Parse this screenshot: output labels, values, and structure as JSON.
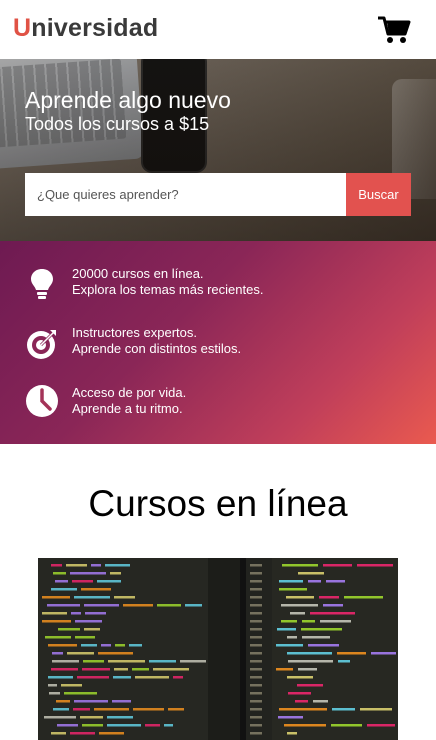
{
  "header": {
    "logo_first": "U",
    "logo_rest": "niversidad",
    "cart_icon": "shopping-cart-icon"
  },
  "hero": {
    "title": "Aprende algo nuevo",
    "subtitle": "Todos los cursos a $15",
    "search_placeholder": "¿Que quieres aprender?",
    "search_button": "Buscar"
  },
  "features": [
    {
      "icon": "lightbulb-icon",
      "line1": "20000 cursos en línea.",
      "line2": "Explora los temas más recientes."
    },
    {
      "icon": "target-icon",
      "line1": "Instructores expertos.",
      "line2": "Aprende con distintos estilos."
    },
    {
      "icon": "clock-icon",
      "line1": "Acceso de por vida.",
      "line2": "Aprende a tu ritmo."
    }
  ],
  "courses": {
    "title": "Cursos en línea"
  },
  "colors": {
    "accent": "#e2524f",
    "gradient_start": "#6e1a52",
    "gradient_end": "#ea5a4f"
  }
}
